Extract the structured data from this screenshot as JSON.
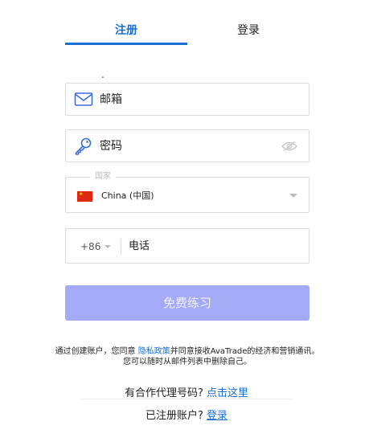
{
  "tabs": {
    "register": "注册",
    "login": "登录"
  },
  "fields": {
    "email_placeholder": "邮箱",
    "password_placeholder": "密码",
    "country_label": "国家",
    "country_value": "China (中国)",
    "dial_code": "+86",
    "phone_placeholder": "电话"
  },
  "submit": {
    "label": "免费练习"
  },
  "consent": {
    "before": "通过创建账户，您同意 ",
    "link": "隐私政策",
    "after": "并同意接收AvaTrade的经济和营销通讯。您可以随时从邮件列表中删除自己。"
  },
  "agent": {
    "question": "有合作代理号码? ",
    "link": "点击这里"
  },
  "account": {
    "question": "已注册账户? ",
    "link": "登录"
  },
  "colors": {
    "accent": "#1a6fd1",
    "button": "#a3aaf6",
    "flag": "#de2910"
  },
  "icons": {
    "email": "envelope-icon",
    "password": "key-icon",
    "visibility": "eye-icon",
    "flag": "china-flag-icon"
  }
}
